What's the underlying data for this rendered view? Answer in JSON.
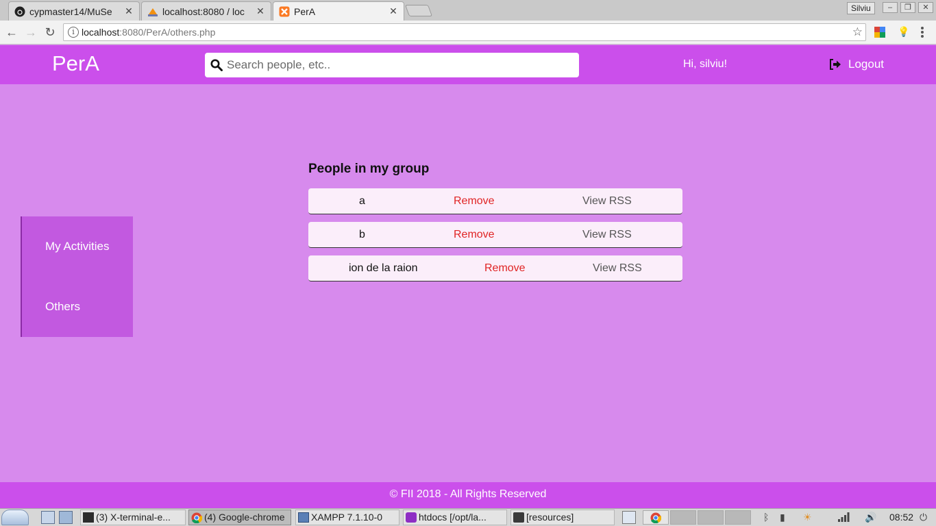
{
  "browser": {
    "tabs": [
      {
        "title": "cypmaster14/MuSe",
        "icon": "github-icon",
        "active": false
      },
      {
        "title": "localhost:8080 / loc",
        "icon": "phpmyadmin-icon",
        "active": false
      },
      {
        "title": "PerA",
        "icon": "xampp-icon",
        "active": true
      }
    ],
    "profile_name": "Silviu",
    "url_host": "localhost",
    "url_path": ":8080/PerA/others.php"
  },
  "header": {
    "brand": "PerA",
    "search_placeholder": "Search people, etc..",
    "greeting": "Hi, silviu!",
    "logout_label": "Logout"
  },
  "sidebar": {
    "items": [
      {
        "label": "My Activities"
      },
      {
        "label": "Others"
      }
    ]
  },
  "content": {
    "title": "People in my group",
    "people": [
      {
        "name": "a",
        "remove_label": "Remove",
        "rss_label": "View RSS"
      },
      {
        "name": "b",
        "remove_label": "Remove",
        "rss_label": "View RSS"
      },
      {
        "name": "ion de la raion",
        "remove_label": "Remove",
        "rss_label": "View RSS"
      }
    ]
  },
  "footer": {
    "text": "FII 2018 - All Rights Reserved"
  },
  "taskbar": {
    "tasks": [
      {
        "label": "(3) X-terminal-e...",
        "active": false
      },
      {
        "label": "(4) Google-chrome",
        "active": true
      },
      {
        "label": "XAMPP 7.1.10-0",
        "active": false
      },
      {
        "label": "htdocs [/opt/la...",
        "active": false
      },
      {
        "label": "[resources]",
        "active": false
      }
    ],
    "clock": "08:52"
  },
  "colors": {
    "header_bg": "#cb4feb",
    "page_bg": "#d78aed",
    "sidebar_bg": "#c259e0",
    "row_bg": "#fbeefa",
    "remove": "#e02424"
  }
}
